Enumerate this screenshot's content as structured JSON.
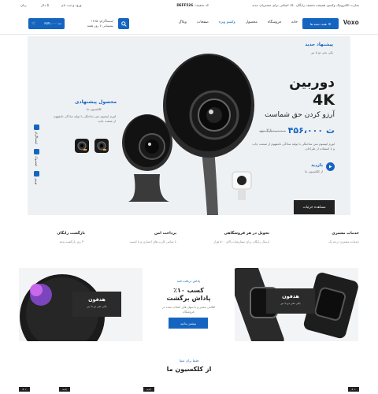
{
  "topbar": {
    "promo": "تجارت الکترونیک وکسو، همیشه تخفیف رایگان ۵۰٪ اضافی برای مشتریان جدید",
    "discount_label": "کد تخفیف:",
    "discount_code": "DEFF526",
    "login": "ورود و ثبت نام",
    "currency": "$ دلار",
    "language": "زبان"
  },
  "header": {
    "logo": "Voxo",
    "category_button": "همه دسته ها",
    "nav": [
      "خانه",
      "فروشگاه",
      "محصول",
      "وکسو ویژه",
      "صفحات",
      "وبلاگ"
    ],
    "support_line1": "اینستاگرام: ۱۴۸۵",
    "support_line2": "پشتیبانی ۷ روز هفته",
    "cart_amount": "۶۵۷،۰۰۰ ت"
  },
  "hero": {
    "new_tag": "پیشنهاد جدید",
    "new_sub": "یکی نخر دو تا ببر",
    "title_line1": "دوربین",
    "title_line2": "4K",
    "subtitle": "آرزو کردن حق شماست",
    "price": "۴۵۶،۰۰۰ ت",
    "old_price": "۴۸۰،۰۰۰ ت",
    "description": "لورم ایپسوم متن ساختگی با تولید سادگی نامفهوم از صنعت چاپ و با استفاده از طراحان.",
    "watch_title": "بازدید",
    "watch_sub": "از کلکسیون ما",
    "detail_button": "مشاهده جزئیات",
    "side_title": "محصول پیشنهادی",
    "side_sub": "کلکسیون ما",
    "side_desc": "لورم ایپسوم متن ساختگی با تولید سادگی نامفهوم از صنعت چاپ.",
    "socials": [
      "اینستاگرام",
      "فیسبوک",
      "توییتر"
    ]
  },
  "features": [
    {
      "title": "خدمات مشتری",
      "sub": "خدمات مشتری درجه یک"
    },
    {
      "title": "تحویل در هر فروشگاهی",
      "sub": "ارسال رایگان برای سفارشات بالای ۵۰۰ هزار"
    },
    {
      "title": "پرداخت امن",
      "sub": "با تمامی کارت های اعتباری و با امنیت"
    },
    {
      "title": "بازگشت رایگان",
      "sub": "۳۰ روز بازگشت وجه"
    }
  ],
  "promos": {
    "left_title": "هدفون",
    "left_sub": "یکی نخر دو تا ببر",
    "mid_tag": "پاداش دریافت کنید",
    "mid_h1": "کسب ۱۰٪",
    "mid_h2": "پاداش برگشت",
    "mid_desc": "اقلامی معتبر و با سهل های انتخاب شده در فروشگاه",
    "mid_button": "بیشتر بدانید",
    "right_title": "هدفون",
    "right_sub": "یکی نخر دو تا ببر"
  },
  "collection": {
    "tag": "فقط برای شما",
    "title": "از کلکسیون ما"
  },
  "mini_tags": [
    "۵۰٪",
    "جدید",
    "جدید",
    "۵۰٪"
  ]
}
